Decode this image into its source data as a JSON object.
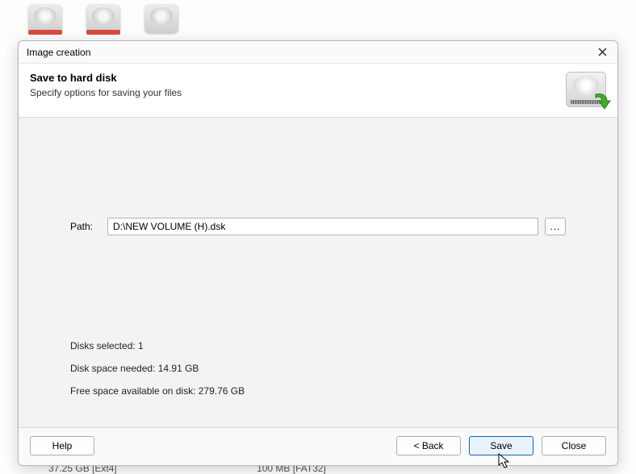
{
  "background": {
    "obscured_left": "37.25 GB [Ext4]",
    "obscured_right": "100 MB [FAT32]"
  },
  "window": {
    "title": "Image creation",
    "header_title": "Save to hard disk",
    "header_subtitle": "Specify options for saving your files"
  },
  "path": {
    "label": "Path:",
    "value": "D:\\NEW VOLUME (H).dsk",
    "browse_label": "..."
  },
  "stats": {
    "disks_selected": "Disks selected: 1",
    "space_needed": "Disk space needed: 14.91 GB",
    "free_space": "Free space available on disk: 279.76 GB"
  },
  "buttons": {
    "help": "Help",
    "back": "< Back",
    "save": "Save",
    "close": "Close"
  }
}
